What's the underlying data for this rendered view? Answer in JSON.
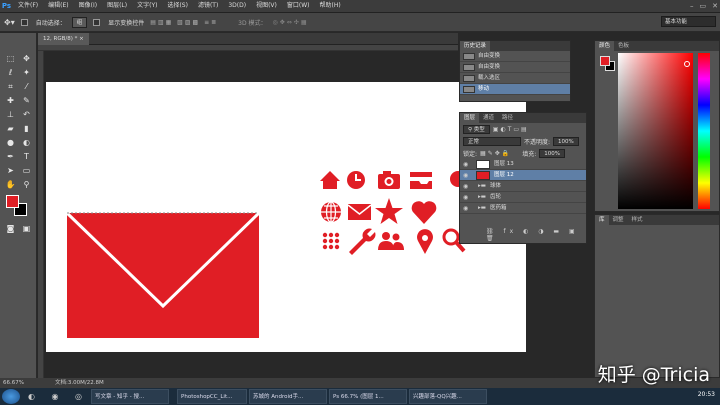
{
  "app": {
    "logo": "Ps"
  },
  "menu": [
    "文件(F)",
    "编辑(E)",
    "图像(I)",
    "图层(L)",
    "文字(Y)",
    "选择(S)",
    "滤镜(T)",
    "3D(D)",
    "视图(V)",
    "窗口(W)",
    "帮助(H)"
  ],
  "options": {
    "auto_select_label": "自动选择：",
    "auto_select_value": "组",
    "show_transform": "显示变换控件",
    "mode_3d": "3D 模式：",
    "workspace": "基本功能"
  },
  "document": {
    "tab": "12, RGB/8) *"
  },
  "history": {
    "tabs": [
      "历史记录"
    ],
    "items": [
      "自由变换",
      "自由变换",
      "载入选区",
      "移动"
    ]
  },
  "layers": {
    "tabs": [
      "图层",
      "通道",
      "路径"
    ],
    "kind": "类型",
    "blend": "正常",
    "opacity_label": "不透明度:",
    "opacity": "100%",
    "lock_label": "锁定:",
    "fill_label": "填充:",
    "fill": "100%",
    "rows": [
      "图层 13",
      "图层 12",
      "球体",
      "齿轮",
      "医药箱"
    ]
  },
  "color": {
    "tabs": [
      "颜色",
      "色板"
    ],
    "fg": "#e01e25",
    "bg": "#000000"
  },
  "adjust": {
    "tabs": [
      "库",
      "调整",
      "样式"
    ]
  },
  "status": {
    "zoom": "66.67%",
    "doc": "文档:3.00M/22.8M"
  },
  "taskbar": {
    "items": [
      "写文章 - 知乎 - 搜...",
      "PhotoshopCC_Lit...",
      "苏城的 Android手...",
      "Ps 66.7% (图层 1...",
      "兴趣部落-QQ兴趣..."
    ],
    "clock": "20:53"
  },
  "watermark": "知乎 @Tricia",
  "accent": "#e01e25"
}
